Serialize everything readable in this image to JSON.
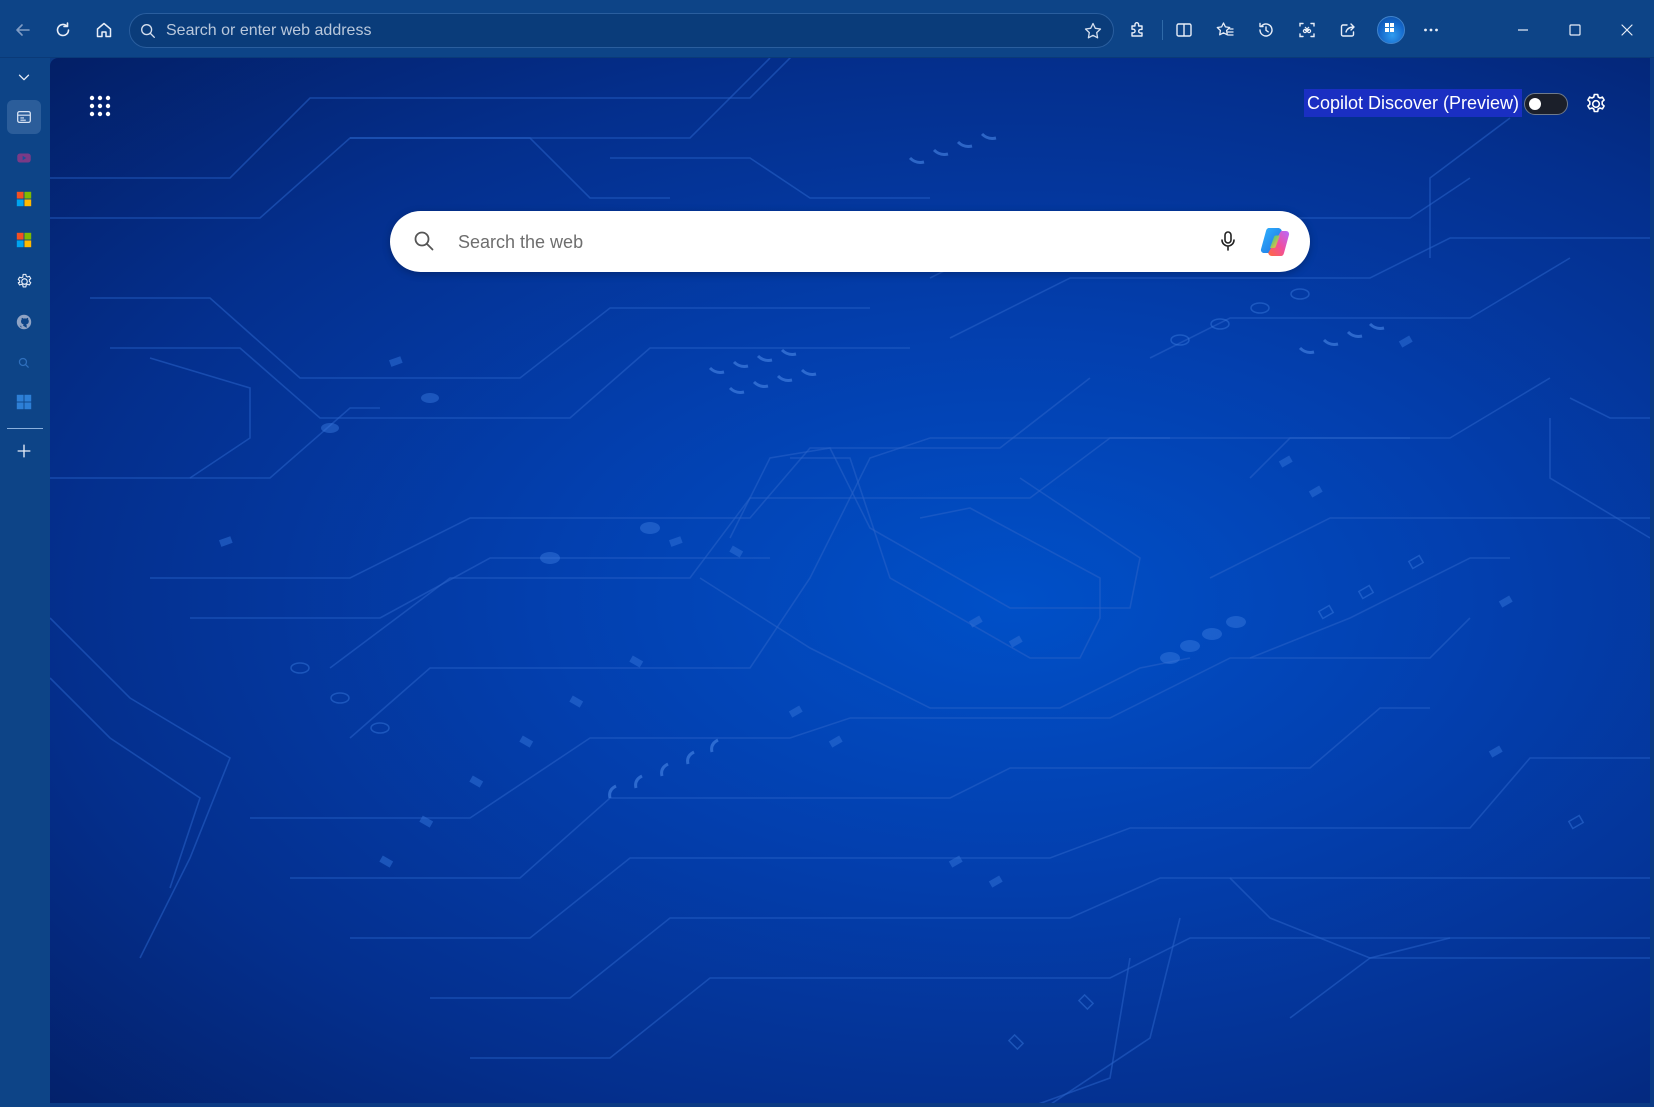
{
  "toolbar": {
    "address_placeholder": "Search or enter web address",
    "icons": [
      "back-icon",
      "refresh-icon",
      "home-icon",
      "search-icon",
      "favorite-star-icon",
      "extensions-icon",
      "split-screen-icon",
      "favorites-icon",
      "history-icon",
      "screenshot-icon",
      "share-icon",
      "profile-avatar",
      "more-icon",
      "minimize-icon",
      "maximize-icon",
      "close-icon"
    ]
  },
  "sidebar": {
    "items": [
      {
        "name": "collapse-chevron-icon"
      },
      {
        "name": "vertical-tabs-icon",
        "active": true
      },
      {
        "name": "youtube-tab-icon"
      },
      {
        "name": "microsoft-tab-icon"
      },
      {
        "name": "microsoft-tab-icon-2"
      },
      {
        "name": "settings-tab-icon"
      },
      {
        "name": "github-tab-icon"
      },
      {
        "name": "search-tab-icon"
      },
      {
        "name": "windows-tab-icon"
      },
      {
        "name": "new-tab-plus-icon"
      }
    ]
  },
  "newtab": {
    "discover_label": "Copilot Discover (Preview)",
    "discover_toggle_on": false,
    "search_placeholder": "Search the web"
  },
  "colors": {
    "chrome": "#0d4487",
    "background_center": "#0050c8",
    "background_edge": "#031f66",
    "label_highlight": "#1a2fc2"
  }
}
